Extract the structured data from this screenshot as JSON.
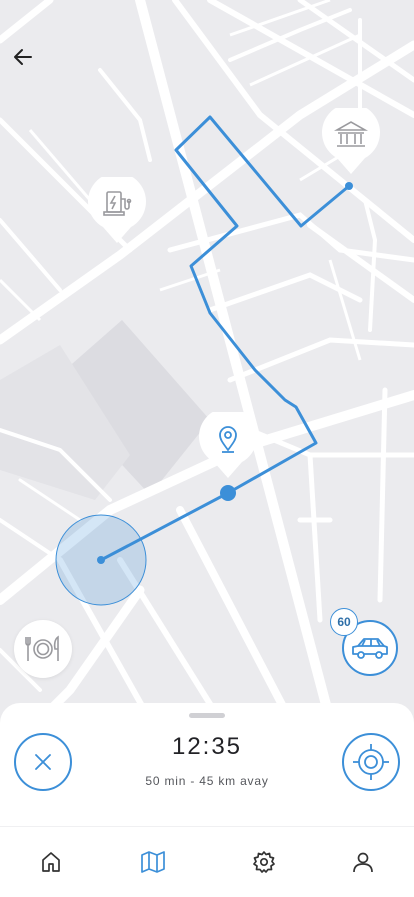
{
  "trip": {
    "eta_time": "12:35",
    "eta_detail": "50 min - 45 km avay",
    "speed_limit": "60"
  },
  "colors": {
    "route": "#3c8fd8",
    "map_background": "#ebebee",
    "road": "#ffffff",
    "block": "#dddde2",
    "accent": "#3c8fd8"
  },
  "icons": {
    "back": "arrow-left-icon",
    "fuel_poi": "ev-charging-station-icon",
    "bank_poi": "bank-icon",
    "location_poi": "location-pin-icon",
    "restaurant_poi": "restaurant-icon",
    "car": "car-icon",
    "cancel": "close-icon",
    "recenter": "crosshair-icon",
    "tab_home": "home-icon",
    "tab_map": "map-icon",
    "tab_settings": "gear-icon",
    "tab_profile": "user-icon"
  },
  "tabs": {
    "active": "map"
  }
}
